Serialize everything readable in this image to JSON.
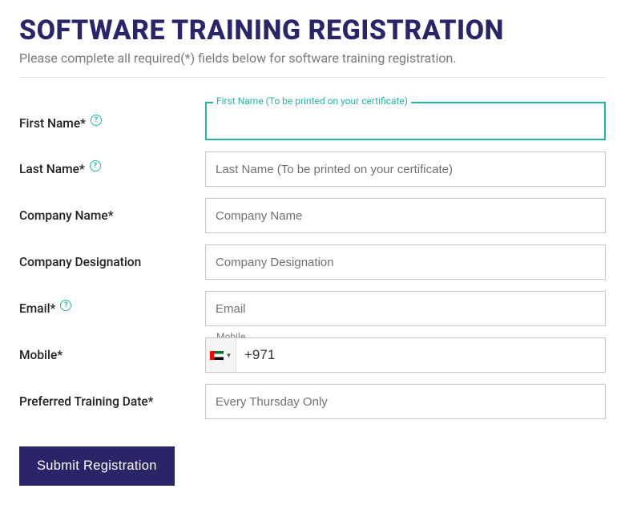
{
  "header": {
    "title": "SOFTWARE TRAINING REGISTRATION",
    "subtitle": "Please complete all required(*) fields below for software training registration."
  },
  "fields": {
    "first_name": {
      "label": "First Name*",
      "float": "First Name (To be printed on your certificate)",
      "value": "",
      "help": "?"
    },
    "last_name": {
      "label": "Last Name*",
      "placeholder": "Last Name (To be printed on your certificate)",
      "help": "?"
    },
    "company_name": {
      "label": "Company Name*",
      "placeholder": "Company Name"
    },
    "company_designation": {
      "label": "Company Designation",
      "placeholder": "Company Designation"
    },
    "email": {
      "label": "Email*",
      "placeholder": "Email",
      "help": "?"
    },
    "mobile": {
      "label": "Mobile*",
      "float": "Mobile",
      "dial_code": "+971",
      "country": "AE"
    },
    "preferred_date": {
      "label": "Preferred Training Date*",
      "placeholder": "Every Thursday Only"
    }
  },
  "submit": {
    "label": "Submit Registration"
  },
  "colors": {
    "brand": "#2a2468",
    "accent": "#21b7a6",
    "muted_text": "#7a7a7a",
    "border": "#c8c8c8"
  }
}
